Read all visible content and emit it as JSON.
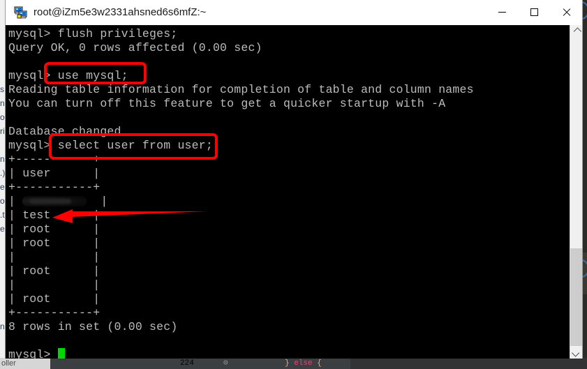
{
  "window": {
    "title": "root@iZm5e3w2331ahsned6s6mfZ:~",
    "icon": "putty-terminal-icon",
    "controls": {
      "minimize_label": "Minimize",
      "maximize_label": "Maximize",
      "close_label": "Close"
    }
  },
  "terminal": {
    "prompt": "mysql>",
    "background_color": "#000000",
    "text_color": "#bcbcbc",
    "cursor_color": "#00d900",
    "lines": [
      {
        "id": "l01",
        "text": "mysql> flush privileges;"
      },
      {
        "id": "l02",
        "text": "Query OK, 0 rows affected (0.00 sec)"
      },
      {
        "id": "l03",
        "text": ""
      },
      {
        "id": "l04",
        "text": "mysql> use mysql;"
      },
      {
        "id": "l05",
        "text": "Reading table information for completion of table and column names"
      },
      {
        "id": "l06",
        "text": "You can turn off this feature to get a quicker startup with -A"
      },
      {
        "id": "l07",
        "text": ""
      },
      {
        "id": "l08",
        "text": "Database changed"
      },
      {
        "id": "l09",
        "text": "mysql> select user from user;"
      },
      {
        "id": "l10",
        "text": "+-----------+"
      },
      {
        "id": "l11",
        "text": "| user      |"
      },
      {
        "id": "l12",
        "text": "+-----------+"
      },
      {
        "id": "l13",
        "text": "|           |",
        "redacted": true
      },
      {
        "id": "l14",
        "text": "| test      |"
      },
      {
        "id": "l15",
        "text": "| root      |"
      },
      {
        "id": "l16",
        "text": "| root      |"
      },
      {
        "id": "l17",
        "text": "|           |"
      },
      {
        "id": "l18",
        "text": "| root      |"
      },
      {
        "id": "l19",
        "text": "|           |"
      },
      {
        "id": "l20",
        "text": "| root      |"
      },
      {
        "id": "l21",
        "text": "+-----------+"
      },
      {
        "id": "l22",
        "text": "8 rows in set (0.00 sec)"
      },
      {
        "id": "l23",
        "text": ""
      },
      {
        "id": "l24",
        "text": "mysql> "
      }
    ],
    "result_table": {
      "columns": [
        "user"
      ],
      "rows": [
        [
          "██████"
        ],
        [
          "test"
        ],
        [
          "root"
        ],
        [
          "root"
        ],
        [
          ""
        ],
        [
          "root"
        ],
        [
          ""
        ],
        [
          "root"
        ]
      ],
      "row_count_text": "8 rows in set (0.00 sec)"
    }
  },
  "annotations": {
    "accent_color": "#ff0000",
    "rect_1_label": "highlight-use-mysql",
    "rect_2_label": "highlight-select-user",
    "arrow_label": "pointer-to-test-user"
  },
  "background": {
    "left_fragments": [
      "s",
      "n",
      "ol",
      "ri",
      "",
      "nd",
      ".)",
      "e",
      "o",
      ".t",
      "e.",
      "",
      "",
      "",
      "",
      "",
      "",
      "nd"
    ],
    "bottom_left_label": "oller",
    "code_line_number": "224",
    "code_text": "} else {",
    "code_keyword": "else"
  }
}
